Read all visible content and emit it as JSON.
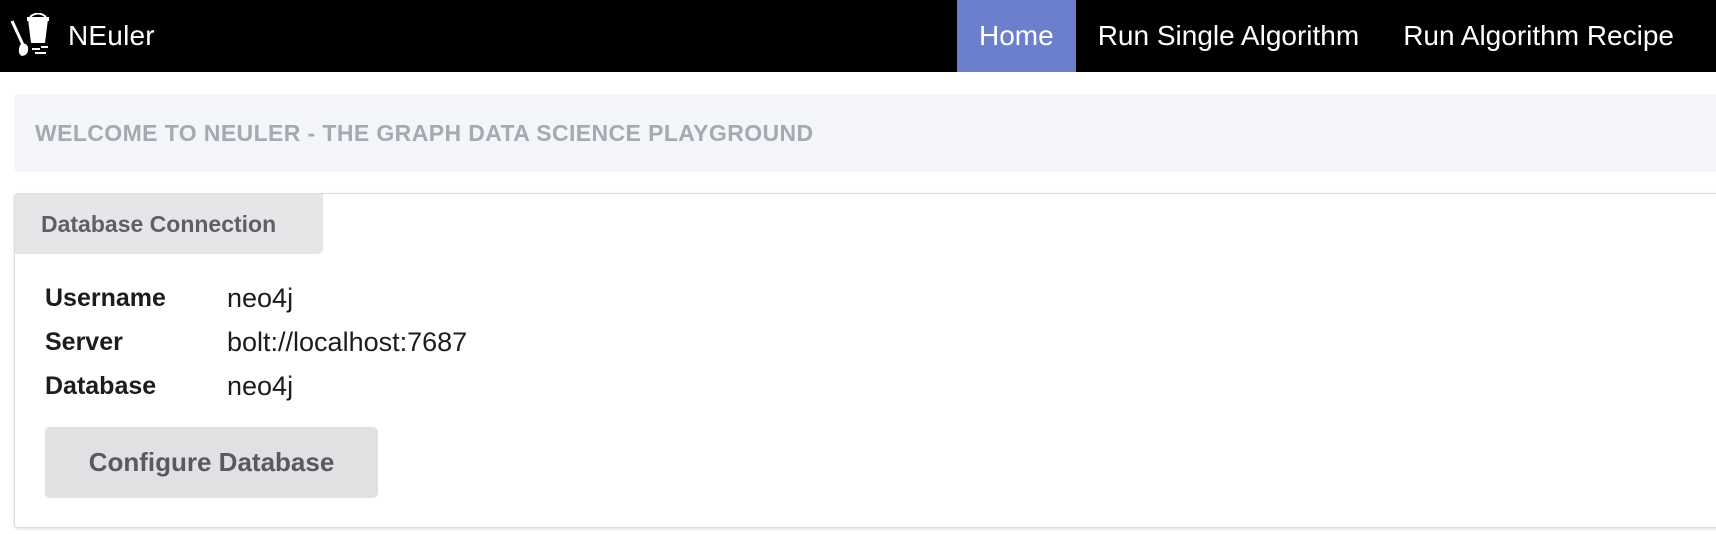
{
  "app": {
    "name": "NEuler",
    "logo_icon": "bucket-shovel-icon"
  },
  "nav": {
    "items": [
      {
        "label": "Home",
        "active": true
      },
      {
        "label": "Run Single Algorithm",
        "active": false
      },
      {
        "label": "Run Algorithm Recipe",
        "active": false
      }
    ],
    "active_color": "#6b7fcd"
  },
  "banner": {
    "text": "WELCOME TO NEULER - THE GRAPH DATA SCIENCE PLAYGROUND"
  },
  "connection": {
    "tab_label": "Database Connection",
    "rows": [
      {
        "label": "Username",
        "value": "neo4j"
      },
      {
        "label": "Server",
        "value": "bolt://localhost:7687"
      },
      {
        "label": "Database",
        "value": "neo4j"
      }
    ],
    "configure_label": "Configure Database"
  }
}
